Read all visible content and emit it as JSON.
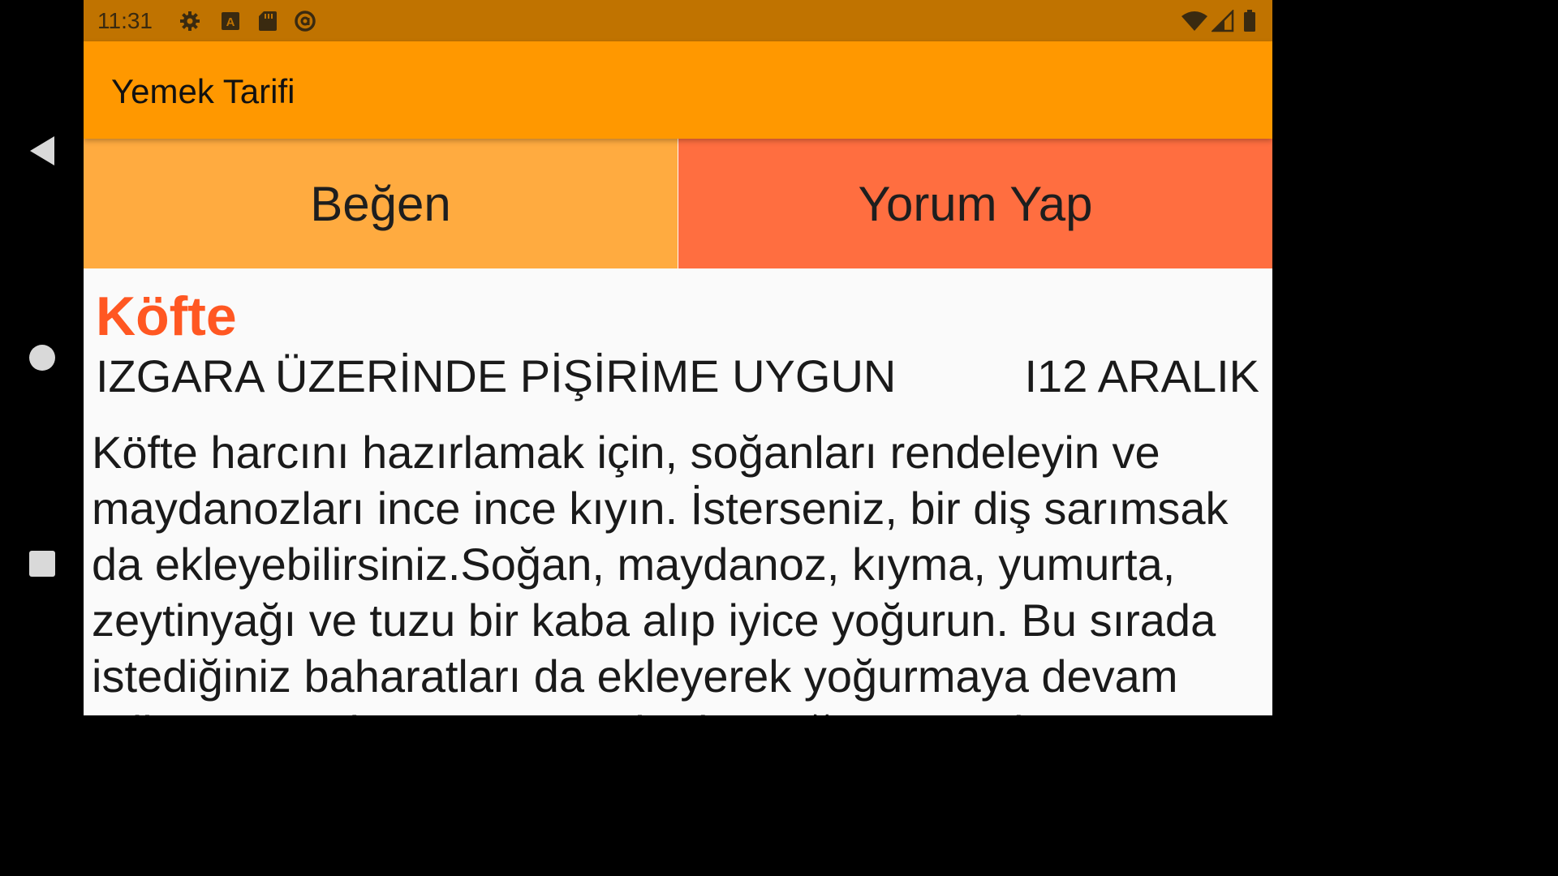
{
  "status_bar": {
    "time": "11:31",
    "left_icons": [
      "settings-icon",
      "font-a-icon",
      "sd-card-icon",
      "at-sign-icon"
    ],
    "right_icons": [
      "wifi-icon",
      "signal-icon",
      "battery-icon"
    ]
  },
  "app_bar": {
    "title": "Yemek Tarifi"
  },
  "actions": {
    "like_label": "Beğen",
    "comment_label": "Yorum Yap"
  },
  "recipe": {
    "title": "Köfte",
    "tag": "IZGARA ÜZERİNDE PİŞİRİME UYGUN",
    "date": "I12 ARALIK",
    "body": "Köfte harcını hazırlamak için, soğanları rendeleyin ve maydanozları ince ince kıyın. İsterseniz, bir diş sarımsak da ekleyebilirsiniz.Soğan, maydanoz, kıyma, yumurta, zeytinyağı ve tuzu bir kaba alıp iyice yoğurun. Bu sırada istediğiniz baharatları da ekleyerek yoğurmaya devam edin. Harcın kıvamı tutana kadar yoğurmaya devam edin."
  },
  "nav": {
    "icons": [
      "back-icon",
      "home-icon",
      "recents-icon"
    ]
  },
  "colors": {
    "status_bar": "#c07300",
    "app_bar": "#ff9800",
    "like_button": "#ffab40",
    "comment_button": "#ff6e40",
    "title_accent": "#ff5722"
  }
}
